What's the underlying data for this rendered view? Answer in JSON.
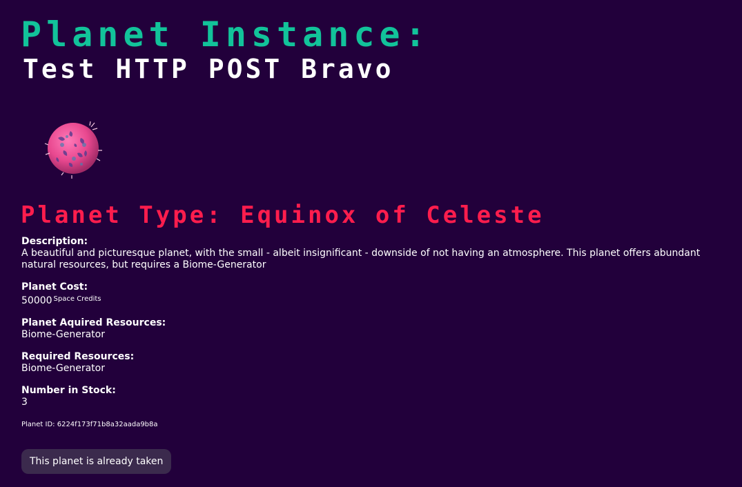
{
  "header": {
    "title_line1": "Planet Instance:",
    "title_line2": "Test HTTP POST Bravo"
  },
  "planet": {
    "image_icon": "planet-icon",
    "type_heading": "Planet Type: Equinox of Celeste",
    "description_label": "Description:",
    "description": "A beautiful and picturesque planet, with the small - albeit insignificant - downside of not having an atmosphere. This planet offers abundant natural resources, but requires a Biome-Generator",
    "cost_label": "Planet Cost:",
    "cost_value": "50000",
    "cost_unit": "Space Credits",
    "acquired_label": "Planet Aquired Resources:",
    "acquired_value": "Biome-Generator",
    "required_label": "Required Resources:",
    "required_value": "Biome-Generator",
    "stock_label": "Number in Stock:",
    "stock_value": "3",
    "planet_id": "Planet ID: 6224f173f71b8a32aada9b8a"
  },
  "action": {
    "taken_label": "This planet is already taken"
  },
  "colors": {
    "background": "#22003b",
    "title_accent": "#12c39a",
    "type_accent": "#ff1d4d",
    "button_bg": "#3b2a4d"
  }
}
